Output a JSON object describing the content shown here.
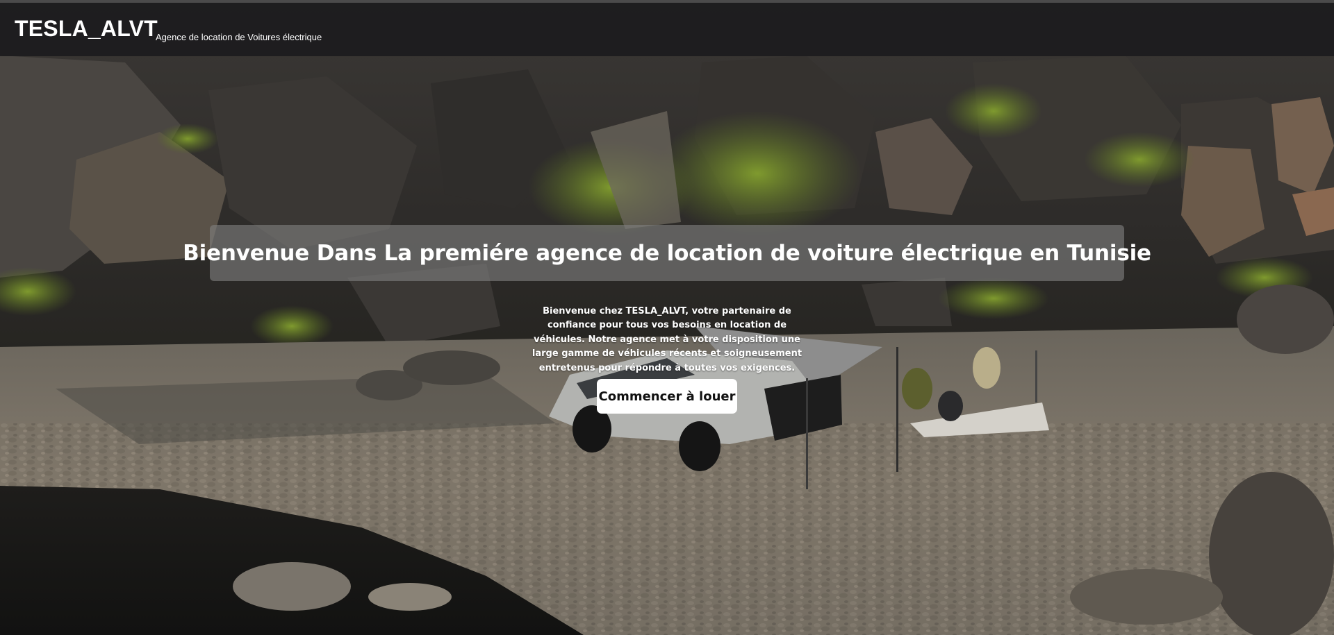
{
  "header": {
    "brand_name": "TESLA_ALVT",
    "tagline": "Agence de location de Voitures électrique"
  },
  "hero": {
    "title": "Bienvenue Dans La premiére agence de location de voiture électrique en Tunisie",
    "description": "Bienvenue chez TESLA_ALVT, votre partenaire de confiance pour tous vos besoins en location de véhicules. Notre agence met à votre disposition une large gamme de véhicules récents et soigneusement entretenus pour répondre à toutes vos exigences.",
    "cta_label": "Commencer à louer"
  },
  "colors": {
    "header_bg": "#1a1a1c",
    "title_box_bg": "#808080",
    "button_bg": "#ffffff",
    "text": "#ffffff"
  }
}
